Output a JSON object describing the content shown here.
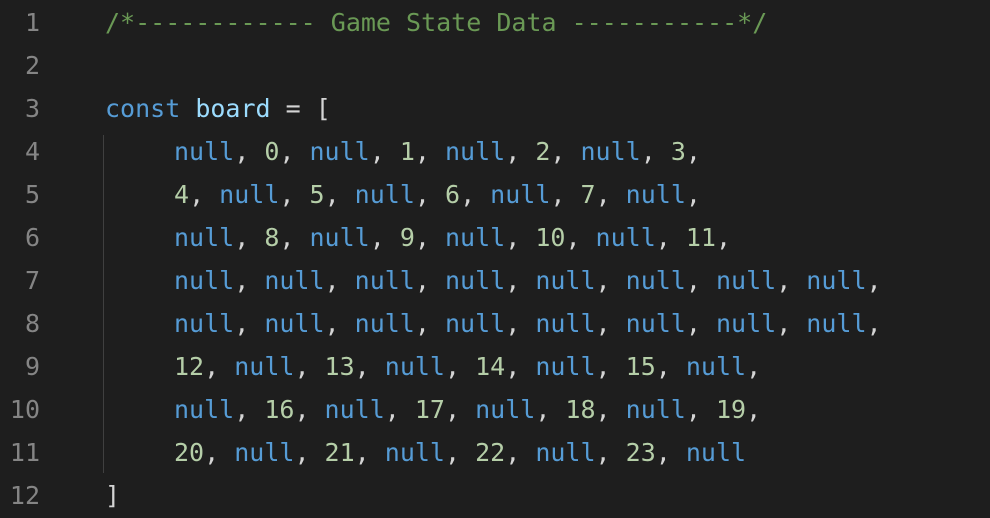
{
  "colors": {
    "background": "#1e1e1e",
    "line_number": "#858585",
    "comment": "#6a9955",
    "keyword": "#569cd6",
    "variable": "#9cdcfe",
    "number": "#b5cea8",
    "punctuation": "#d4d4d4"
  },
  "lines": [
    {
      "number": "1",
      "indent": false,
      "tokens": [
        {
          "t": "comment",
          "v": "/*------------ Game State Data -----------*/"
        }
      ]
    },
    {
      "number": "2",
      "indent": false,
      "tokens": []
    },
    {
      "number": "3",
      "indent": false,
      "tokens": [
        {
          "t": "keyword",
          "v": "const"
        },
        {
          "t": "punc",
          "v": " "
        },
        {
          "t": "var",
          "v": "board"
        },
        {
          "t": "punc",
          "v": " = ["
        }
      ]
    },
    {
      "number": "4",
      "indent": true,
      "tokens": [
        {
          "t": "keyword",
          "v": "null"
        },
        {
          "t": "punc",
          "v": ", "
        },
        {
          "t": "num",
          "v": "0"
        },
        {
          "t": "punc",
          "v": ", "
        },
        {
          "t": "keyword",
          "v": "null"
        },
        {
          "t": "punc",
          "v": ", "
        },
        {
          "t": "num",
          "v": "1"
        },
        {
          "t": "punc",
          "v": ", "
        },
        {
          "t": "keyword",
          "v": "null"
        },
        {
          "t": "punc",
          "v": ", "
        },
        {
          "t": "num",
          "v": "2"
        },
        {
          "t": "punc",
          "v": ", "
        },
        {
          "t": "keyword",
          "v": "null"
        },
        {
          "t": "punc",
          "v": ", "
        },
        {
          "t": "num",
          "v": "3"
        },
        {
          "t": "punc",
          "v": ","
        }
      ]
    },
    {
      "number": "5",
      "indent": true,
      "tokens": [
        {
          "t": "num",
          "v": "4"
        },
        {
          "t": "punc",
          "v": ", "
        },
        {
          "t": "keyword",
          "v": "null"
        },
        {
          "t": "punc",
          "v": ", "
        },
        {
          "t": "num",
          "v": "5"
        },
        {
          "t": "punc",
          "v": ", "
        },
        {
          "t": "keyword",
          "v": "null"
        },
        {
          "t": "punc",
          "v": ", "
        },
        {
          "t": "num",
          "v": "6"
        },
        {
          "t": "punc",
          "v": ", "
        },
        {
          "t": "keyword",
          "v": "null"
        },
        {
          "t": "punc",
          "v": ", "
        },
        {
          "t": "num",
          "v": "7"
        },
        {
          "t": "punc",
          "v": ", "
        },
        {
          "t": "keyword",
          "v": "null"
        },
        {
          "t": "punc",
          "v": ","
        }
      ]
    },
    {
      "number": "6",
      "indent": true,
      "tokens": [
        {
          "t": "keyword",
          "v": "null"
        },
        {
          "t": "punc",
          "v": ", "
        },
        {
          "t": "num",
          "v": "8"
        },
        {
          "t": "punc",
          "v": ", "
        },
        {
          "t": "keyword",
          "v": "null"
        },
        {
          "t": "punc",
          "v": ", "
        },
        {
          "t": "num",
          "v": "9"
        },
        {
          "t": "punc",
          "v": ", "
        },
        {
          "t": "keyword",
          "v": "null"
        },
        {
          "t": "punc",
          "v": ", "
        },
        {
          "t": "num",
          "v": "10"
        },
        {
          "t": "punc",
          "v": ", "
        },
        {
          "t": "keyword",
          "v": "null"
        },
        {
          "t": "punc",
          "v": ", "
        },
        {
          "t": "num",
          "v": "11"
        },
        {
          "t": "punc",
          "v": ","
        }
      ]
    },
    {
      "number": "7",
      "indent": true,
      "tokens": [
        {
          "t": "keyword",
          "v": "null"
        },
        {
          "t": "punc",
          "v": ", "
        },
        {
          "t": "keyword",
          "v": "null"
        },
        {
          "t": "punc",
          "v": ", "
        },
        {
          "t": "keyword",
          "v": "null"
        },
        {
          "t": "punc",
          "v": ", "
        },
        {
          "t": "keyword",
          "v": "null"
        },
        {
          "t": "punc",
          "v": ", "
        },
        {
          "t": "keyword",
          "v": "null"
        },
        {
          "t": "punc",
          "v": ", "
        },
        {
          "t": "keyword",
          "v": "null"
        },
        {
          "t": "punc",
          "v": ", "
        },
        {
          "t": "keyword",
          "v": "null"
        },
        {
          "t": "punc",
          "v": ", "
        },
        {
          "t": "keyword",
          "v": "null"
        },
        {
          "t": "punc",
          "v": ","
        }
      ]
    },
    {
      "number": "8",
      "indent": true,
      "tokens": [
        {
          "t": "keyword",
          "v": "null"
        },
        {
          "t": "punc",
          "v": ", "
        },
        {
          "t": "keyword",
          "v": "null"
        },
        {
          "t": "punc",
          "v": ", "
        },
        {
          "t": "keyword",
          "v": "null"
        },
        {
          "t": "punc",
          "v": ", "
        },
        {
          "t": "keyword",
          "v": "null"
        },
        {
          "t": "punc",
          "v": ", "
        },
        {
          "t": "keyword",
          "v": "null"
        },
        {
          "t": "punc",
          "v": ", "
        },
        {
          "t": "keyword",
          "v": "null"
        },
        {
          "t": "punc",
          "v": ", "
        },
        {
          "t": "keyword",
          "v": "null"
        },
        {
          "t": "punc",
          "v": ", "
        },
        {
          "t": "keyword",
          "v": "null"
        },
        {
          "t": "punc",
          "v": ","
        }
      ]
    },
    {
      "number": "9",
      "indent": true,
      "tokens": [
        {
          "t": "num",
          "v": "12"
        },
        {
          "t": "punc",
          "v": ", "
        },
        {
          "t": "keyword",
          "v": "null"
        },
        {
          "t": "punc",
          "v": ", "
        },
        {
          "t": "num",
          "v": "13"
        },
        {
          "t": "punc",
          "v": ", "
        },
        {
          "t": "keyword",
          "v": "null"
        },
        {
          "t": "punc",
          "v": ", "
        },
        {
          "t": "num",
          "v": "14"
        },
        {
          "t": "punc",
          "v": ", "
        },
        {
          "t": "keyword",
          "v": "null"
        },
        {
          "t": "punc",
          "v": ", "
        },
        {
          "t": "num",
          "v": "15"
        },
        {
          "t": "punc",
          "v": ", "
        },
        {
          "t": "keyword",
          "v": "null"
        },
        {
          "t": "punc",
          "v": ","
        }
      ]
    },
    {
      "number": "10",
      "indent": true,
      "tokens": [
        {
          "t": "keyword",
          "v": "null"
        },
        {
          "t": "punc",
          "v": ", "
        },
        {
          "t": "num",
          "v": "16"
        },
        {
          "t": "punc",
          "v": ", "
        },
        {
          "t": "keyword",
          "v": "null"
        },
        {
          "t": "punc",
          "v": ", "
        },
        {
          "t": "num",
          "v": "17"
        },
        {
          "t": "punc",
          "v": ", "
        },
        {
          "t": "keyword",
          "v": "null"
        },
        {
          "t": "punc",
          "v": ", "
        },
        {
          "t": "num",
          "v": "18"
        },
        {
          "t": "punc",
          "v": ", "
        },
        {
          "t": "keyword",
          "v": "null"
        },
        {
          "t": "punc",
          "v": ", "
        },
        {
          "t": "num",
          "v": "19"
        },
        {
          "t": "punc",
          "v": ","
        }
      ]
    },
    {
      "number": "11",
      "indent": true,
      "tokens": [
        {
          "t": "num",
          "v": "20"
        },
        {
          "t": "punc",
          "v": ", "
        },
        {
          "t": "keyword",
          "v": "null"
        },
        {
          "t": "punc",
          "v": ", "
        },
        {
          "t": "num",
          "v": "21"
        },
        {
          "t": "punc",
          "v": ", "
        },
        {
          "t": "keyword",
          "v": "null"
        },
        {
          "t": "punc",
          "v": ", "
        },
        {
          "t": "num",
          "v": "22"
        },
        {
          "t": "punc",
          "v": ", "
        },
        {
          "t": "keyword",
          "v": "null"
        },
        {
          "t": "punc",
          "v": ", "
        },
        {
          "t": "num",
          "v": "23"
        },
        {
          "t": "punc",
          "v": ", "
        },
        {
          "t": "keyword",
          "v": "null"
        }
      ]
    },
    {
      "number": "12",
      "indent": false,
      "tokens": [
        {
          "t": "punc",
          "v": "]"
        }
      ]
    }
  ]
}
